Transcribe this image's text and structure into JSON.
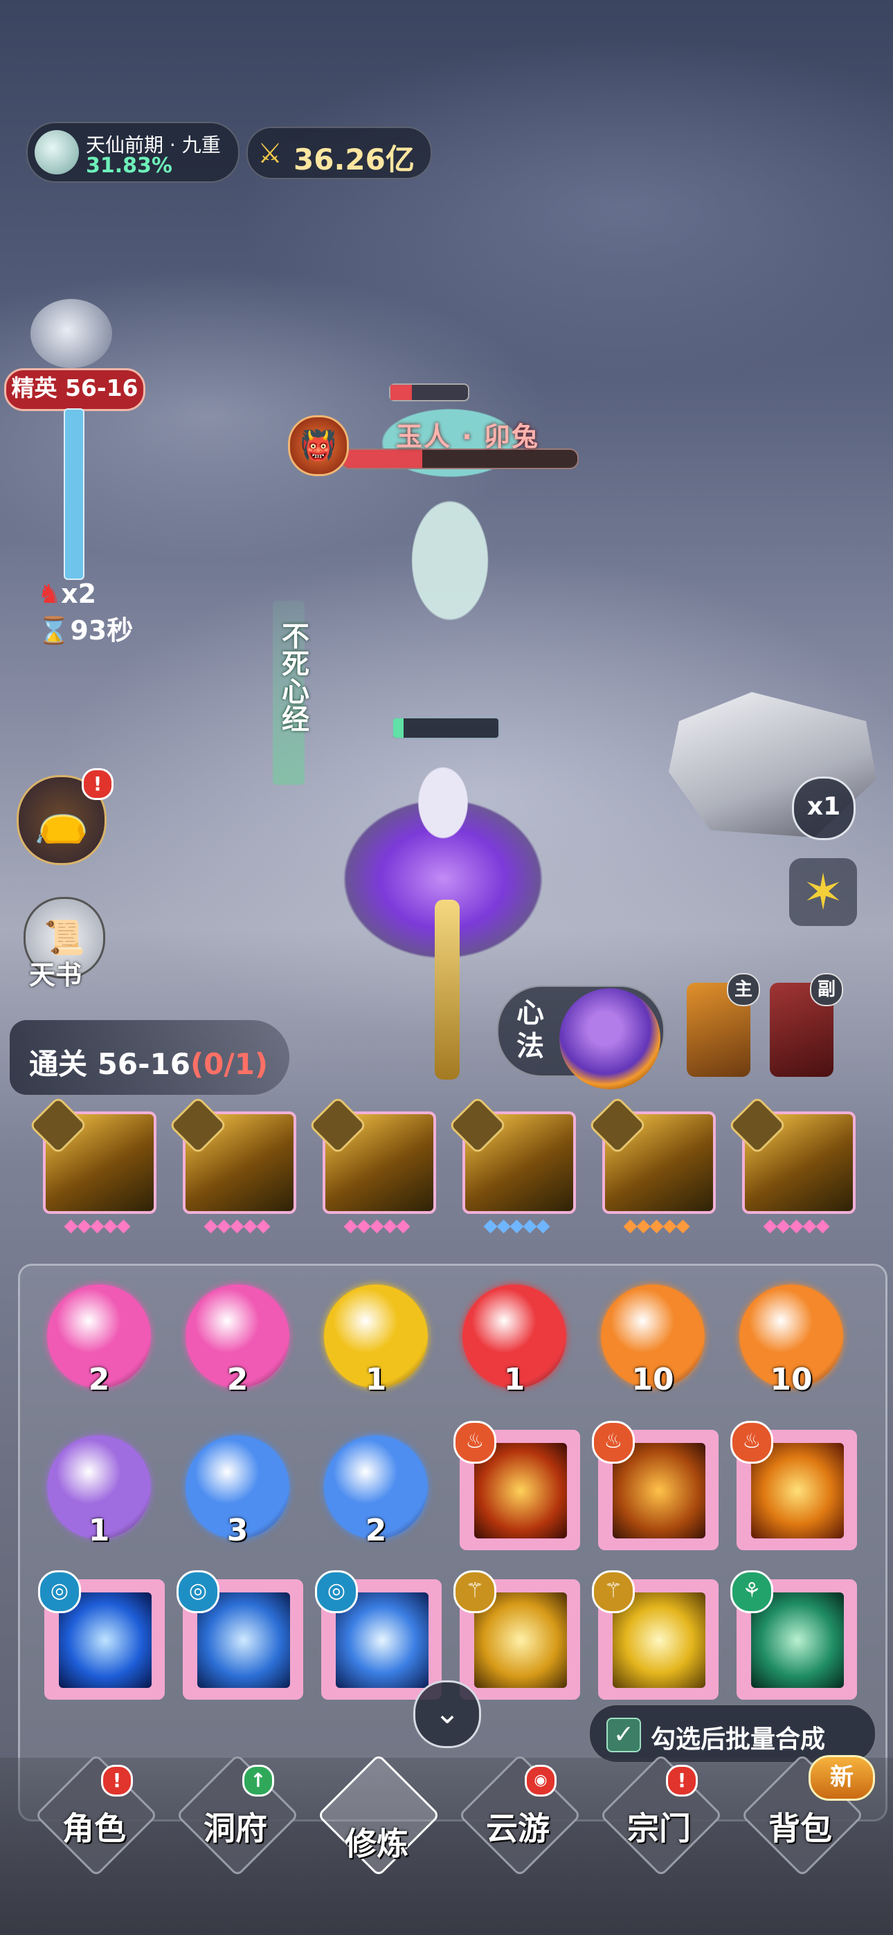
{
  "hud": {
    "realm_name": "天仙前期 · 九重",
    "realm_progress": "31.83%",
    "combat_power": "36.26亿",
    "power_icon": "crossed-swords-icon"
  },
  "stage": {
    "badge": "精英 56-16",
    "multiplier": "x2",
    "timer": "93秒"
  },
  "enemy": {
    "name": "玉人 · 卯兔",
    "hp_fraction": 0.34
  },
  "player": {
    "active_skill": "不死心经",
    "hp_fraction": 0.1
  },
  "controls": {
    "speed": "x1",
    "tianshu_label": "天书",
    "bag_badge": "!"
  },
  "clear": {
    "prefix": "通关 56-16",
    "progress": "(0/1)"
  },
  "xinfa": {
    "label": "心法"
  },
  "weapons": {
    "main_tag": "主",
    "sub_tag": "副"
  },
  "orbs": [
    {
      "count": "2",
      "color": "#f05ab4"
    },
    {
      "count": "2",
      "color": "#f05ab4"
    },
    {
      "count": "1",
      "color": "#f2c21c"
    },
    {
      "count": "1",
      "color": "#ec3a3f"
    },
    {
      "count": "10",
      "color": "#f4882a"
    },
    {
      "count": "10",
      "color": "#f4882a"
    },
    {
      "count": "1",
      "color": "#a06de0"
    },
    {
      "count": "3",
      "color": "#4e8ef0"
    },
    {
      "count": "2",
      "color": "#4e8ef0"
    }
  ],
  "batch": {
    "label": "勾选后批量合成",
    "checked": true
  },
  "nav": [
    {
      "label": "角色",
      "badge": "!"
    },
    {
      "label": "洞府",
      "badge": "↑"
    },
    {
      "label": "修炼",
      "badge": ""
    },
    {
      "label": "云游",
      "badge": ""
    },
    {
      "label": "宗门",
      "badge": "!"
    },
    {
      "label": "背包",
      "badge": "新"
    }
  ],
  "colors": {
    "accent_green": "#6ef0b9",
    "gold": "#fde6a0",
    "red": "#b1232a"
  }
}
